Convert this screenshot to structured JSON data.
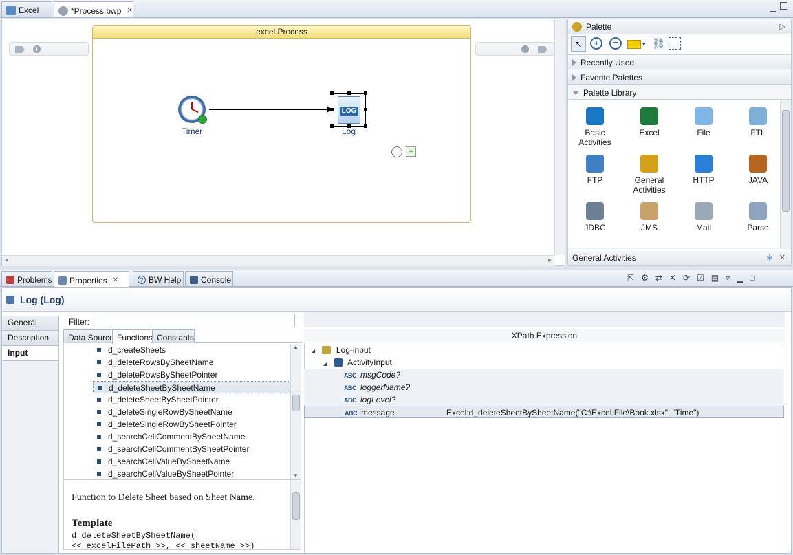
{
  "editor": {
    "tabs": [
      {
        "label": "Excel"
      },
      {
        "label": "*Process.bwp"
      }
    ]
  },
  "process": {
    "title": "excel.Process",
    "timer_label": "Timer",
    "log_label": "Log",
    "log_icon_text": "LOG"
  },
  "palette": {
    "title": "Palette",
    "recently_used": "Recently Used",
    "favorite_palettes": "Favorite Palettes",
    "palette_library": "Palette Library",
    "items": [
      {
        "label": "Basic\nActivities",
        "icon": "basic-activities-icon",
        "color": "#1a78c2"
      },
      {
        "label": "Excel",
        "icon": "excel-icon",
        "color": "#1e7a3c"
      },
      {
        "label": "File",
        "icon": "file-icon",
        "color": "#7fb6e8"
      },
      {
        "label": "FTL",
        "icon": "ftl-icon",
        "color": "#7fb0d8"
      },
      {
        "label": "FTP",
        "icon": "ftp-icon",
        "color": "#3f7fc4"
      },
      {
        "label": "General\nActivities",
        "icon": "general-activities-icon",
        "color": "#d4a017"
      },
      {
        "label": "HTTP",
        "icon": "http-icon",
        "color": "#2a7fd6"
      },
      {
        "label": "JAVA",
        "icon": "java-icon",
        "color": "#b5651d"
      },
      {
        "label": "JDBC",
        "icon": "jdbc-icon",
        "color": "#6d7f95"
      },
      {
        "label": "JMS",
        "icon": "jms-icon",
        "color": "#c8a26a"
      },
      {
        "label": "Mail",
        "icon": "mail-icon",
        "color": "#9aa8b8"
      },
      {
        "label": "Parse",
        "icon": "parse-icon",
        "color": "#8ea3bd"
      }
    ],
    "footer": "General Activities"
  },
  "bottom": {
    "tabs": [
      {
        "label": "Problems"
      },
      {
        "label": "Properties"
      },
      {
        "label": "BW Help"
      },
      {
        "label": "Console"
      }
    ]
  },
  "properties": {
    "title": "Log (Log)",
    "side_tabs": [
      "General",
      "Description",
      "Input"
    ],
    "filter_label": "Filter:",
    "filter_value": "",
    "inner_tabs": [
      "Data Source",
      "Functions",
      "Constants"
    ],
    "functions": [
      "d_createSheets",
      "d_deleteRowsBySheetName",
      "d_deleteRowsBySheetPointer",
      "d_deleteSheetBySheetName",
      "d_deleteSheetBySheetPointer",
      "d_deleteSingleRowBySheetName",
      "d_deleteSingleRowBySheetPointer",
      "d_searchCellCommentBySheetName",
      "d_searchCellCommentBySheetPointer",
      "d_searchCellValueBySheetName",
      "d_searchCellValueBySheetPointer"
    ],
    "selected_function_index": 3,
    "description": "Function to Delete Sheet based on Sheet Name.",
    "template_heading": "Template",
    "template_line1": "d_deleteSheetBySheetName(",
    "template_line2": "<< excelFilePath >>, << sheetName >>)",
    "xpath_header": "XPath Expression",
    "tree": {
      "root": "Log-input",
      "child": "ActivityInput",
      "fields": [
        {
          "name": "msgCode?",
          "value": ""
        },
        {
          "name": "loggerName?",
          "value": ""
        },
        {
          "name": "logLevel?",
          "value": ""
        },
        {
          "name": "message",
          "value": "Excel:d_deleteSheetBySheetName(\"C:\\Excel File\\Book.xlsx\", \"Time\")"
        }
      ]
    },
    "abc_label": "ABC"
  }
}
